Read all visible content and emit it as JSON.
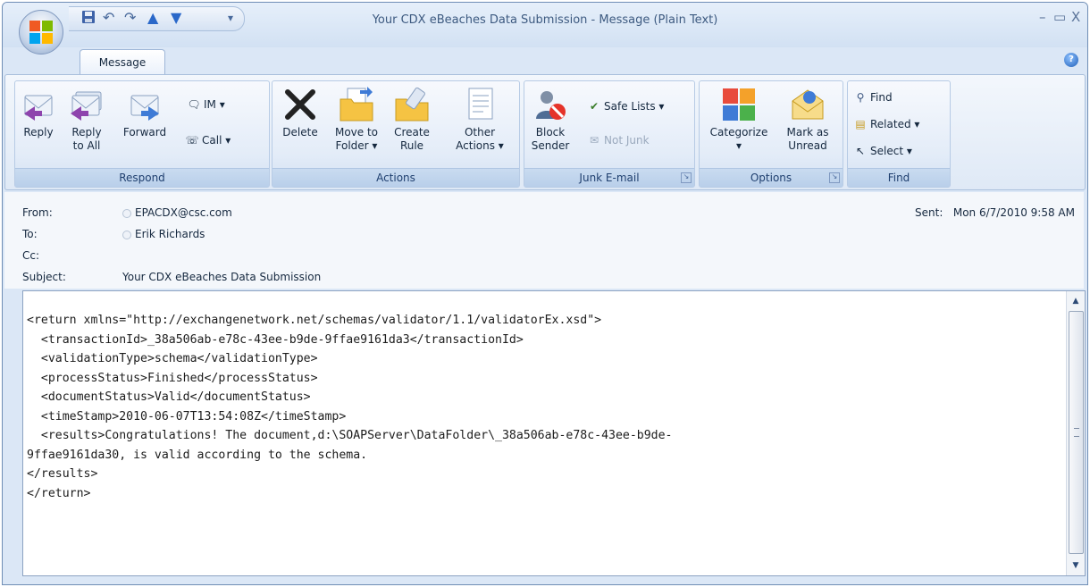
{
  "window": {
    "title": "Your CDX eBeaches Data Submission  - Message (Plain Text)",
    "minimize_glyph": "–",
    "restore_glyph": "▭",
    "close_glyph": "X"
  },
  "qat": {
    "save_icon": "save-icon",
    "undo_icon": "undo-icon",
    "redo_icon": "redo-icon",
    "up_icon": "previous-item-icon",
    "down_icon": "next-item-icon",
    "customize_icon": "customize-icon"
  },
  "tabs": [
    {
      "label": "Message",
      "active": true
    }
  ],
  "ribbon": {
    "respond": {
      "label": "Respond",
      "reply": "Reply",
      "reply_all_1": "Reply",
      "reply_all_2": "to All",
      "forward": "Forward",
      "im": "IM ▾",
      "call": "Call ▾"
    },
    "actions": {
      "label": "Actions",
      "delete": "Delete",
      "move_1": "Move to",
      "move_2": "Folder ▾",
      "create_1": "Create",
      "create_2": "Rule",
      "other_1": "Other",
      "other_2": "Actions ▾"
    },
    "junk": {
      "label": "Junk E-mail",
      "block_1": "Block",
      "block_2": "Sender",
      "safe_lists": "Safe Lists ▾",
      "not_junk": "Not Junk"
    },
    "options": {
      "label": "Options",
      "categorize": "Categorize",
      "categorize_arrow": "▾",
      "mark_1": "Mark as",
      "mark_2": "Unread"
    },
    "find": {
      "label": "Find",
      "find": "Find",
      "related": "Related ▾",
      "select": "Select ▾"
    }
  },
  "header": {
    "from_label": "From:",
    "from_value": "EPACDX@csc.com",
    "to_label": "To:",
    "to_value": "Erik Richards",
    "cc_label": "Cc:",
    "subject_label": "Subject:",
    "subject_value": "Your CDX eBeaches Data Submission",
    "sent_label": "Sent:",
    "sent_value": "Mon 6/7/2010 9:58 AM"
  },
  "body": {
    "lines": [
      "<return xmlns=\"http://exchangenetwork.net/schemas/validator/1.1/validatorEx.xsd\">",
      "  <transactionId>_38a506ab-e78c-43ee-b9de-9ffae9161da3</transactionId>",
      "  <validationType>schema</validationType>",
      "  <processStatus>Finished</processStatus>",
      "  <documentStatus>Valid</documentStatus>",
      "  <timeStamp>2010-06-07T13:54:08Z</timeStamp>",
      "  <results>Congratulations! The document,d:\\SOAPServer\\DataFolder\\_38a506ab-e78c-43ee-b9de-",
      "9ffae9161da30, is valid according to the schema.",
      "</results>",
      "</return>"
    ]
  },
  "colors": {
    "ribbon_label": "#b9cfea",
    "window_border": "#6f8db5",
    "accent": "#1f5fb8"
  }
}
